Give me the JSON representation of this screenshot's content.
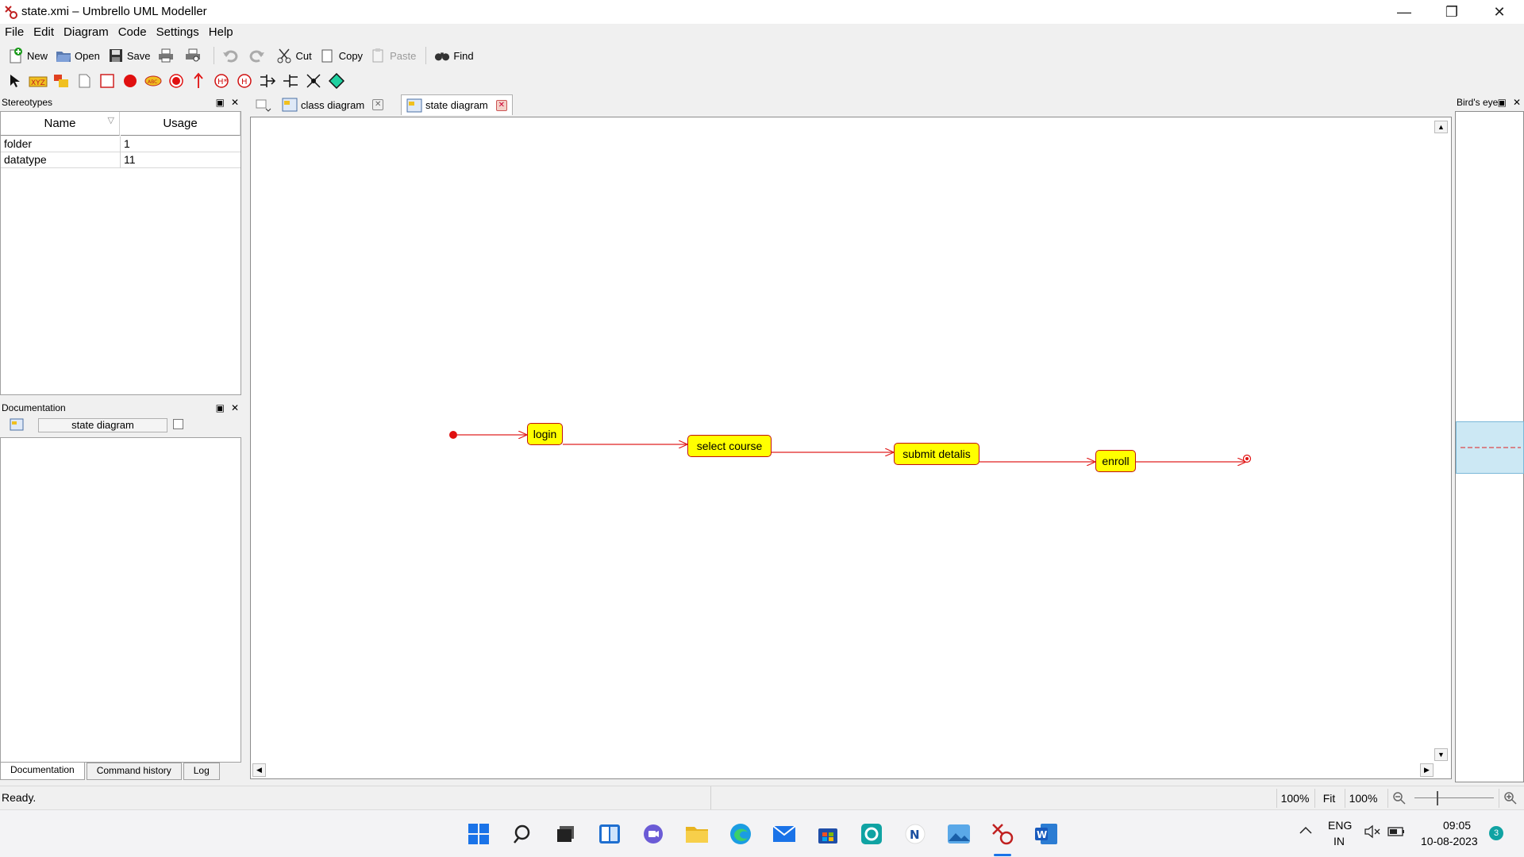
{
  "window": {
    "title": "state.xmi – Umbrello UML Modeller",
    "minimize": "—",
    "restore": "❐",
    "close": "✕"
  },
  "menu": [
    "File",
    "Edit",
    "Diagram",
    "Code",
    "Settings",
    "Help"
  ],
  "toolbar": {
    "new": "New",
    "open": "Open",
    "save": "Save",
    "cut": "Cut",
    "copy": "Copy",
    "paste": "Paste",
    "find": "Find"
  },
  "stereotypes": {
    "title": "Stereotypes",
    "columns": [
      "Name",
      "Usage"
    ],
    "rows": [
      {
        "name": "folder",
        "usage": "1"
      },
      {
        "name": "datatype",
        "usage": "11"
      }
    ]
  },
  "documentation": {
    "title": "Documentation",
    "diagram_name": "state diagram",
    "tabs": [
      "Documentation",
      "Command history",
      "Log"
    ]
  },
  "diagram_tabs": [
    {
      "label": "class diagram"
    },
    {
      "label": "state diagram"
    }
  ],
  "states": [
    "login",
    "select course",
    "submit detalis",
    "enroll"
  ],
  "birds_eye": {
    "title": "Bird's eye"
  },
  "status": {
    "text": "Ready.",
    "zoom1": "100%",
    "fit": "Fit",
    "zoom2": "100%"
  },
  "taskbar": {
    "lang1": "ENG",
    "lang2": "IN",
    "time": "09:05",
    "date": "10-08-2023",
    "notif_count": "3"
  },
  "colors": {
    "state_fill": "#ffff00",
    "edge": "#e02020",
    "selection": "#cce8f4"
  }
}
